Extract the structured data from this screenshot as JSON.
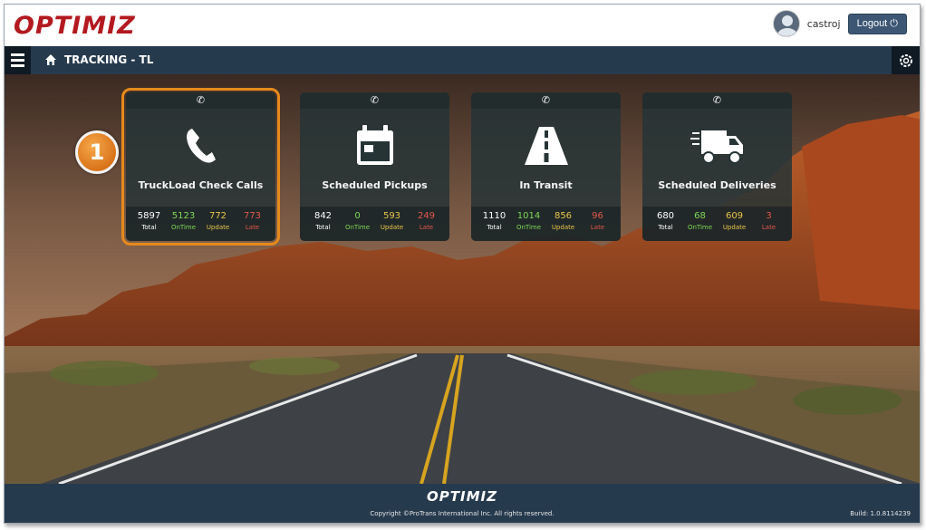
{
  "header": {
    "logo": "OPTIMIZ",
    "username": "castroj",
    "logout_label": "Logout ⏻"
  },
  "nav": {
    "title": "TRACKING - TL"
  },
  "step_badge": "1",
  "tiles": [
    {
      "title": "TruckLoad Check Calls",
      "icon": "phone-icon",
      "phone_glyph": "✆",
      "selected": true,
      "stats": {
        "total": "5897",
        "ontime": "5123",
        "update": "772",
        "late": "773"
      }
    },
    {
      "title": "Scheduled Pickups",
      "icon": "calendar-icon",
      "phone_glyph": "✆",
      "selected": false,
      "stats": {
        "total": "842",
        "ontime": "0",
        "update": "593",
        "late": "249"
      }
    },
    {
      "title": "In Transit",
      "icon": "road-icon",
      "phone_glyph": "✆",
      "selected": false,
      "stats": {
        "total": "1110",
        "ontime": "1014",
        "update": "856",
        "late": "96"
      }
    },
    {
      "title": "Scheduled Deliveries",
      "icon": "truck-icon",
      "phone_glyph": "✆",
      "selected": false,
      "stats": {
        "total": "680",
        "ontime": "68",
        "update": "609",
        "late": "3"
      }
    }
  ],
  "stat_labels": {
    "total": "Total",
    "ontime": "OnTime",
    "update": "Update",
    "late": "Late"
  },
  "footer": {
    "logo": "OPTIMIZ",
    "copyright": "Copyright ©ProTrans International Inc. All rights reserved.",
    "build": "Build: 1.0.8114239"
  },
  "colors": {
    "accent": "#e68a1c",
    "nav": "#263a4e",
    "ontime": "#7ed957",
    "update": "#e8c64a",
    "late": "#e4574a"
  }
}
